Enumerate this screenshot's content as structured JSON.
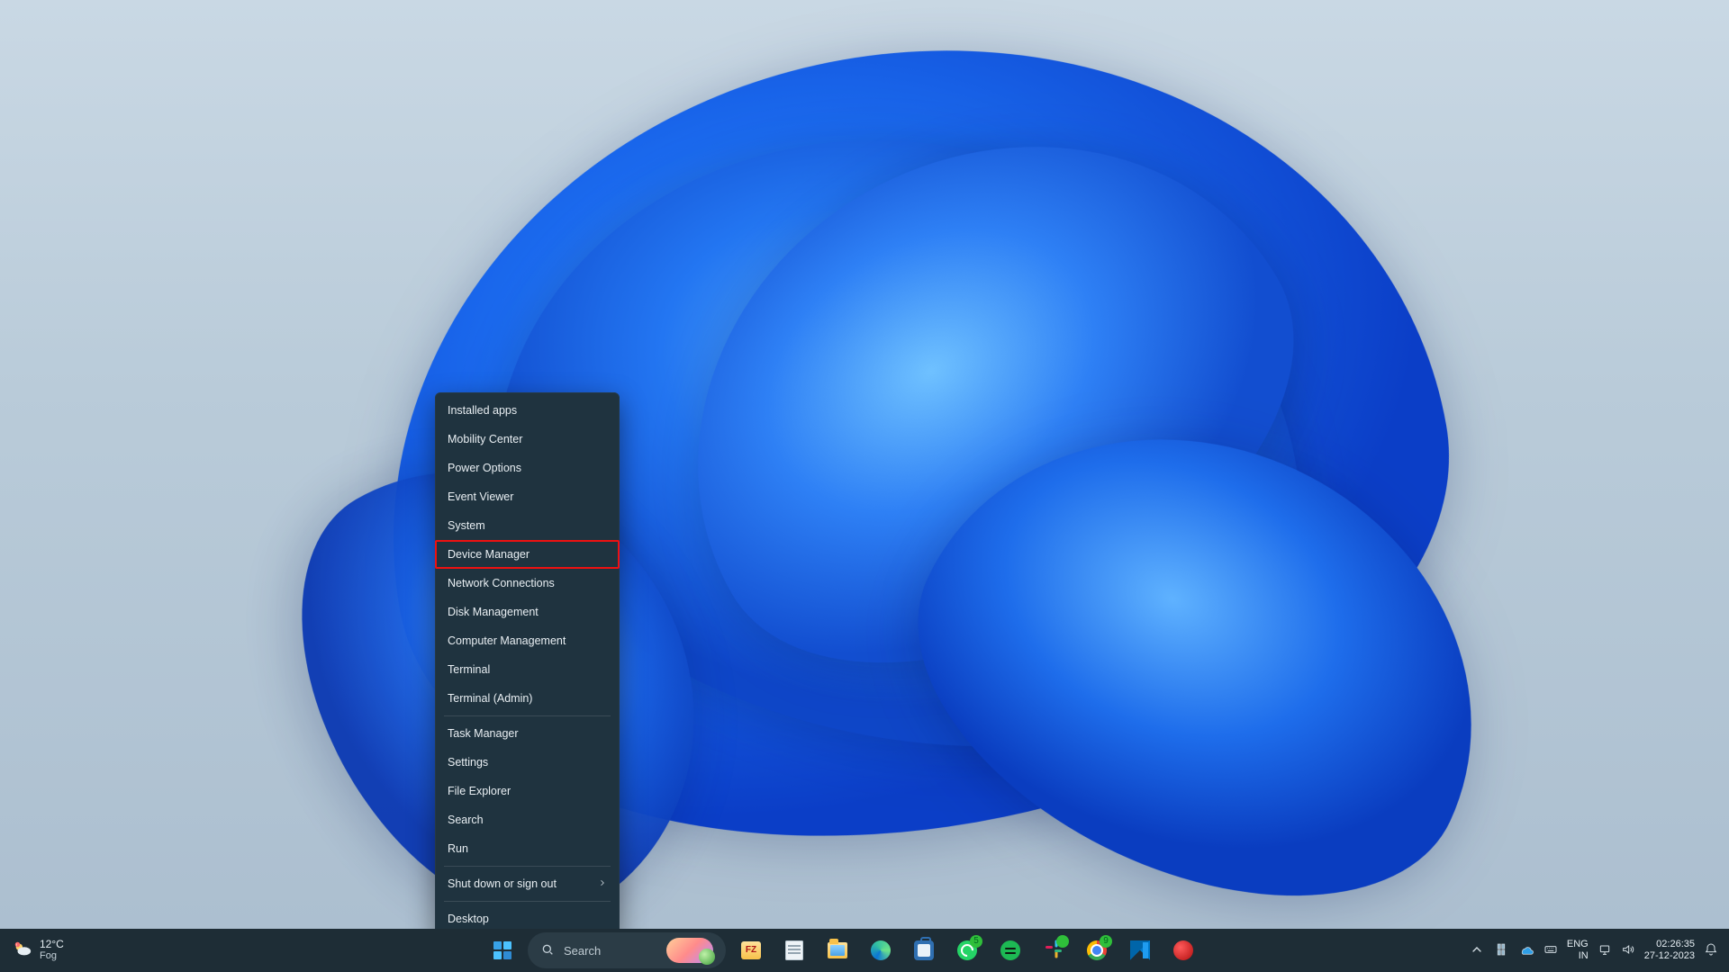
{
  "winx_menu": {
    "highlight_index": 5,
    "groups": [
      [
        {
          "label": "Installed apps"
        },
        {
          "label": "Mobility Center"
        },
        {
          "label": "Power Options"
        },
        {
          "label": "Event Viewer"
        },
        {
          "label": "System"
        },
        {
          "label": "Device Manager"
        },
        {
          "label": "Network Connections"
        },
        {
          "label": "Disk Management"
        },
        {
          "label": "Computer Management"
        },
        {
          "label": "Terminal"
        },
        {
          "label": "Terminal (Admin)"
        }
      ],
      [
        {
          "label": "Task Manager"
        },
        {
          "label": "Settings"
        },
        {
          "label": "File Explorer"
        },
        {
          "label": "Search"
        },
        {
          "label": "Run"
        }
      ],
      [
        {
          "label": "Shut down or sign out",
          "submenu": true
        }
      ],
      [
        {
          "label": "Desktop"
        }
      ]
    ]
  },
  "taskbar": {
    "widgets": {
      "temp": "12°C",
      "condition": "Fog"
    },
    "search_placeholder": "Search",
    "apps": [
      {
        "name": "start-button",
        "glyph": "start"
      },
      {
        "name": "search-button",
        "glyph": "search"
      },
      {
        "name": "filezilla-button",
        "glyph": "fz"
      },
      {
        "name": "notepad-button",
        "glyph": "notepad"
      },
      {
        "name": "file-explorer-button",
        "glyph": "explorer"
      },
      {
        "name": "edge-button",
        "glyph": "edge"
      },
      {
        "name": "store-button",
        "glyph": "store"
      },
      {
        "name": "whatsapp-button",
        "glyph": "whatsapp",
        "badge": "5"
      },
      {
        "name": "spotify-button",
        "glyph": "spotify"
      },
      {
        "name": "slack-button",
        "glyph": "slack",
        "badge": " "
      },
      {
        "name": "chrome-button",
        "glyph": "chrome",
        "badge": "9"
      },
      {
        "name": "vscode-button",
        "glyph": "vscode"
      },
      {
        "name": "avira-button",
        "glyph": "red"
      },
      {
        "name": "settings-button",
        "glyph": "settings"
      }
    ],
    "tray": {
      "language_primary": "ENG",
      "language_secondary": "IN",
      "time": "02:26:35",
      "date": "27-12-2023"
    }
  }
}
